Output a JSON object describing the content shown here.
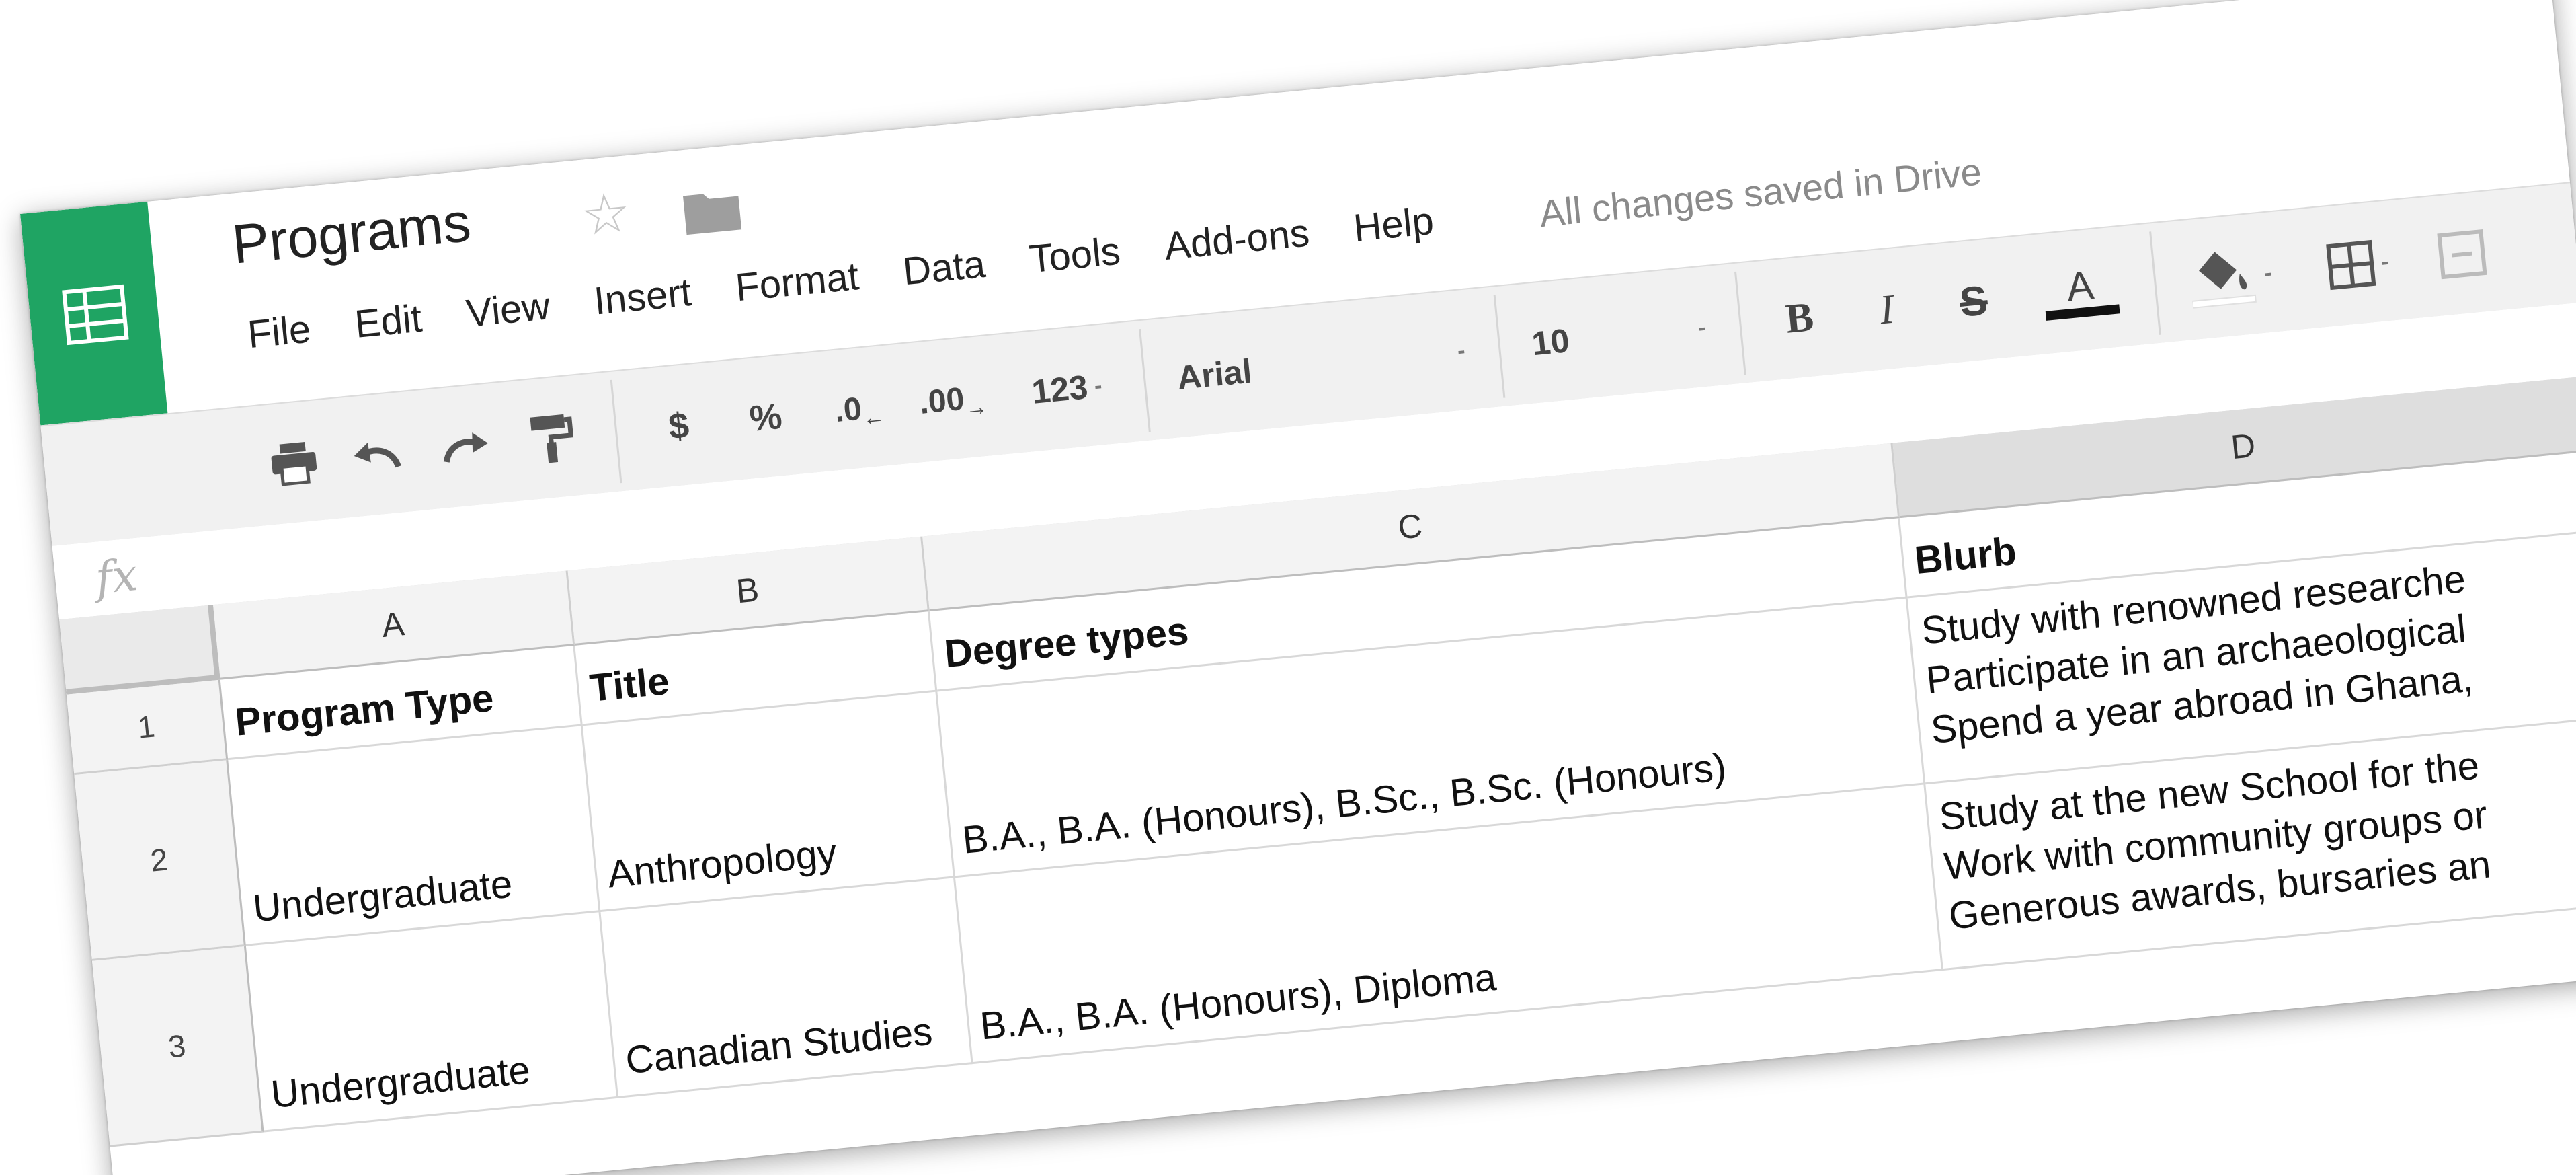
{
  "app": {
    "document_title": "Programs",
    "save_status": "All changes saved in Drive",
    "brand_color": "#1fa463"
  },
  "menu": {
    "items": [
      "File",
      "Edit",
      "View",
      "Insert",
      "Format",
      "Data",
      "Tools",
      "Add-ons",
      "Help"
    ]
  },
  "toolbar": {
    "print_icon": "printer-icon",
    "undo_icon": "undo-icon",
    "redo_icon": "redo-icon",
    "paint_format_icon": "paint-format-icon",
    "currency_label": "$",
    "percent_label": "%",
    "decrease_decimal_label": ".0",
    "increase_decimal_label": ".00",
    "more_formats_label": "123",
    "font_family": "Arial",
    "font_size": "10",
    "bold_label": "B",
    "italic_label": "I",
    "strikethrough_label": "S",
    "text_color_label": "A",
    "dropdown_caret": "-",
    "text_color_bar": "#111111"
  },
  "formula_bar": {
    "fx_label": "fx",
    "value": ""
  },
  "grid": {
    "columns": [
      "A",
      "B",
      "C",
      "D"
    ],
    "selected_column": "D",
    "rows": [
      "1",
      "2",
      "3"
    ],
    "cells": [
      [
        "Program Type",
        "Title",
        "Degree types",
        "Blurb"
      ],
      [
        "Undergraduate",
        "Anthropology",
        "B.A., B.A. (Honours), B.Sc., B.Sc. (Honours)",
        [
          "Study with renowned researche",
          "Participate in an archaeological",
          "Spend a year abroad in Ghana,"
        ]
      ],
      [
        "Undergraduate",
        "Canadian Studies",
        "B.A., B.A. (Honours), Diploma",
        [
          "Study at the new School for the",
          "Work with community groups or",
          "Generous awards, bursaries an"
        ]
      ]
    ]
  }
}
